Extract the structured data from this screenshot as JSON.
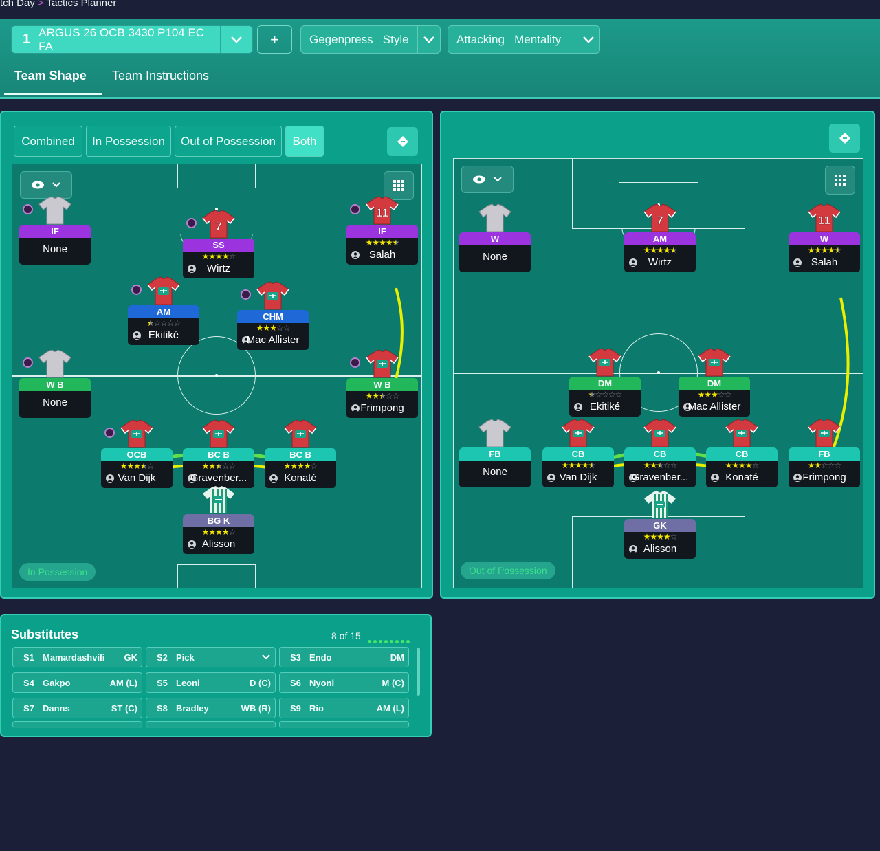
{
  "breadcrumb": {
    "part1": "tch Day",
    "separator": ">",
    "part2": "Tactics Planner"
  },
  "tactic": {
    "number": "1",
    "name": "ARGUS 26 OCB 3430 P104 EC FA"
  },
  "style": {
    "label": "Gegenpress   Style"
  },
  "mentality": {
    "label": "Attacking   Mentality"
  },
  "plus_label": "+",
  "tabs": [
    "Team Shape",
    "Team Instructions"
  ],
  "view_modes": [
    "Combined",
    "In Possession",
    "Out of Possession",
    "Both"
  ],
  "active_view_mode": "Both",
  "in_possession": {
    "label": "In Possession",
    "players": [
      {
        "role": "IF",
        "name": "None",
        "stars": 0
      },
      {
        "role": "SS",
        "name": "Wirtz",
        "stars": 4,
        "number": "7"
      },
      {
        "role": "IF",
        "name": "Salah",
        "stars": 4.5,
        "number": "11"
      },
      {
        "role": "AM",
        "name": "Ekitiké",
        "stars": 0.5
      },
      {
        "role": "CHM",
        "name": "Mac Allister",
        "stars": 3
      },
      {
        "role": "W B",
        "name": "None",
        "stars": 0
      },
      {
        "role": "W B",
        "name": "Frimpong",
        "stars": 2.5
      },
      {
        "role": "OCB",
        "name": "Van Dijk",
        "stars": 3.5
      },
      {
        "role": "BC B",
        "name": "Gravenber...",
        "stars": 2.5
      },
      {
        "role": "BC B",
        "name": "Konaté",
        "stars": 4
      },
      {
        "role": "BG K",
        "name": "Alisson",
        "stars": 4
      }
    ]
  },
  "out_of_possession": {
    "label": "Out of Possession",
    "players": [
      {
        "role": "W",
        "name": "None",
        "stars": 0
      },
      {
        "role": "AM",
        "name": "Wirtz",
        "stars": 4.5,
        "number": "7"
      },
      {
        "role": "W",
        "name": "Salah",
        "stars": 4.5,
        "number": "11"
      },
      {
        "role": "DM",
        "name": "Ekitiké",
        "stars": 0.5
      },
      {
        "role": "DM",
        "name": "Mac Allister",
        "stars": 3
      },
      {
        "role": "FB",
        "name": "None",
        "stars": 0
      },
      {
        "role": "CB",
        "name": "Van Dijk",
        "stars": 4.5
      },
      {
        "role": "CB",
        "name": "Gravenber...",
        "stars": 2.5
      },
      {
        "role": "CB",
        "name": "Konaté",
        "stars": 4
      },
      {
        "role": "FB",
        "name": "Frimpong",
        "stars": 2
      },
      {
        "role": "GK",
        "name": "Alisson",
        "stars": 4
      }
    ]
  },
  "substitutes": {
    "title": "Substitutes",
    "count": "8 of 15",
    "filled": 8,
    "items": [
      {
        "id": "S1",
        "name": "Mamardashvili",
        "pos": "GK"
      },
      {
        "id": "S2",
        "name": "Pick",
        "pos": ""
      },
      {
        "id": "S3",
        "name": "Endo",
        "pos": "DM"
      },
      {
        "id": "S4",
        "name": "Gakpo",
        "pos": "AM (L)"
      },
      {
        "id": "S5",
        "name": "Leoni",
        "pos": "D (C)"
      },
      {
        "id": "S6",
        "name": "Nyoni",
        "pos": "M (C)"
      },
      {
        "id": "S7",
        "name": "Danns",
        "pos": "ST (C)"
      },
      {
        "id": "S8",
        "name": "Bradley",
        "pos": "WB (R)"
      },
      {
        "id": "S9",
        "name": "Rio",
        "pos": "AM (L)"
      }
    ]
  },
  "colors": {
    "accent": "#3fe0c6",
    "pitch": "#0c7a6c",
    "panel": "#0aa08a",
    "background": "#1b1f37",
    "star": "#f1e300",
    "link_line": "#e8f000"
  }
}
